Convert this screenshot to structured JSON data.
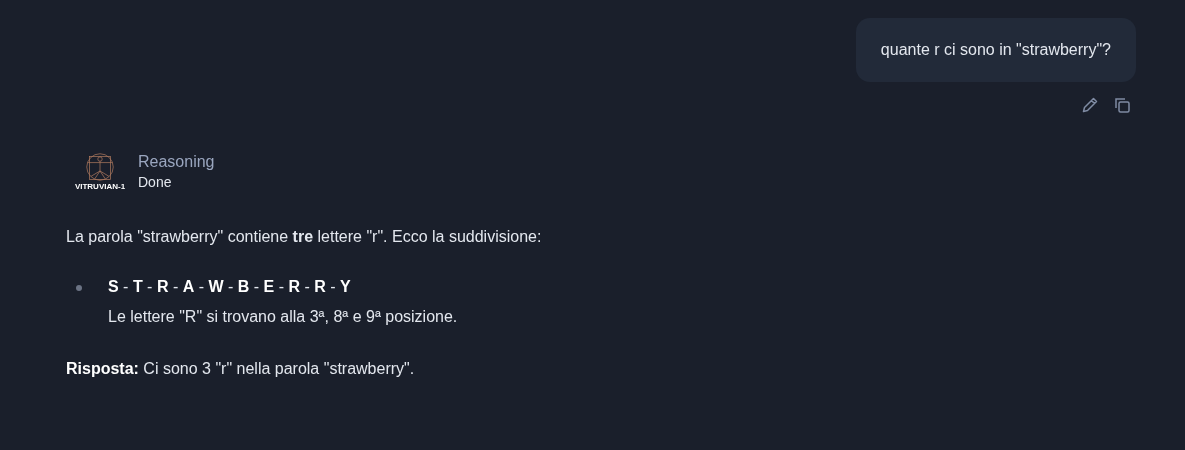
{
  "user_message": {
    "text": "quante r ci sono in \"strawberry\"?"
  },
  "assistant": {
    "avatar_label": "VITRUVIAN-1",
    "reasoning_title": "Reasoning",
    "reasoning_status": "Done",
    "paragraphs": [
      "La parola \"strawberry\" contiene **tre** lettere \"r\". Ecco la suddivisione:"
    ],
    "bullets": [
      {
        "title": "**S** - **T** - **R** - **A** - **W** - **B** - **E** - **R** - **R** - **Y**",
        "detail": "Le lettere \"R\" si trovano alla 3ª, 8ª e 9ª posizione."
      }
    ],
    "answer": "**Risposta:** Ci sono 3 \"r\" nella parola \"strawberry\"."
  }
}
